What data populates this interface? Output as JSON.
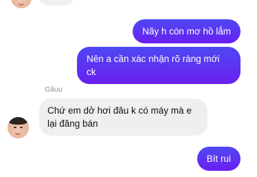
{
  "conversation": {
    "messages": [
      {
        "id": "m1",
        "direction": "outgoing",
        "text": "Nãy h còn mơ hồ lắm"
      },
      {
        "id": "m2",
        "direction": "outgoing",
        "text": "Nên a cần xác nhận rõ ràng mới ck"
      },
      {
        "id": "m3",
        "direction": "incoming",
        "sender": "Gấuu",
        "text": "Chứ em dở hơi đâu k có máy mà e lại đăng bán"
      },
      {
        "id": "m4",
        "direction": "outgoing",
        "text": "Bít rui"
      }
    ]
  },
  "colors": {
    "outgoing_bubble": "#5b2af5",
    "incoming_bubble": "#eeeff1",
    "sender_label": "#8a8d91"
  }
}
